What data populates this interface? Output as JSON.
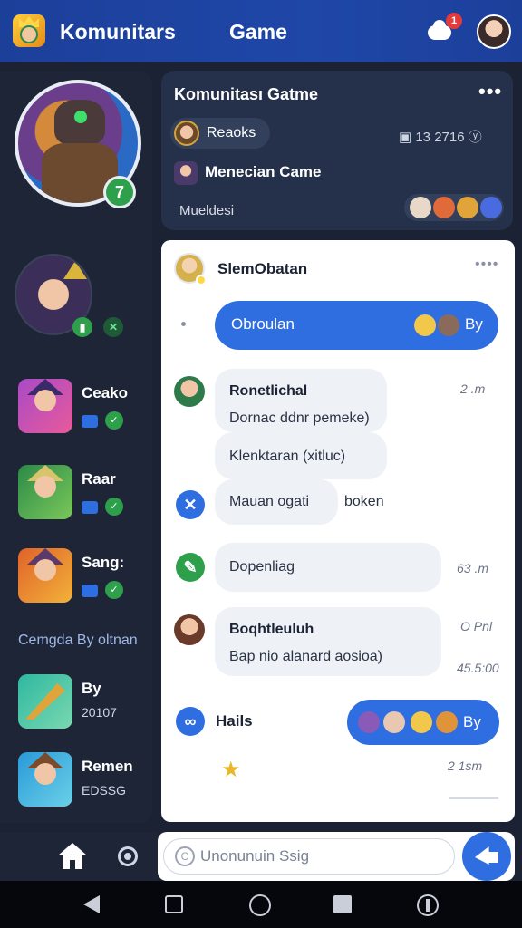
{
  "header": {
    "title": "Komunitars",
    "subtitle": "Game",
    "notification_count": "1"
  },
  "sidebar": {
    "games": [
      {
        "label": "Ceako"
      },
      {
        "label": "Raar"
      },
      {
        "label": "Sang:"
      }
    ],
    "section_label": "Cemgda By oltnan",
    "recent": [
      {
        "label": "By",
        "meta": "20107"
      },
      {
        "label": "Remen",
        "meta": "EDSSG"
      }
    ]
  },
  "community": {
    "title": "Komunitası Gatme",
    "more": "•••",
    "reaction_label": "Reaoks",
    "stats": "▣ 13  2716 ⓨ",
    "game": "Menecian Came",
    "footer": "Mueldesi"
  },
  "chat": {
    "header_name": "SlemObatan",
    "more": "••••",
    "outgoing_1": {
      "text": "Obroulan",
      "by": "By"
    },
    "message_1": {
      "name": "Ronetlichal",
      "line1": "Dornac ddnr pemeke)",
      "line2": "Klenktaran (xitluc)",
      "line3": "Mauan ogati",
      "line3_tail": "boken",
      "time": "2 .m"
    },
    "message_2": {
      "text": "Dopenliag",
      "time": "63 .m"
    },
    "message_3": {
      "name": "Boqhtleuluh",
      "text": "Bap nio alanard aosioa)",
      "time": "O Pnl",
      "meta": "45.5:00"
    },
    "hails": {
      "name": "Hails",
      "by": "By"
    },
    "last_time": "2 1sm"
  },
  "composer": {
    "placeholder": "Unonunuin Ssig"
  },
  "colors": {
    "header_blue": "#1f47a8",
    "accent_blue": "#2f6ee0",
    "green": "#2ea04c",
    "badge_red": "#e23b3b"
  }
}
